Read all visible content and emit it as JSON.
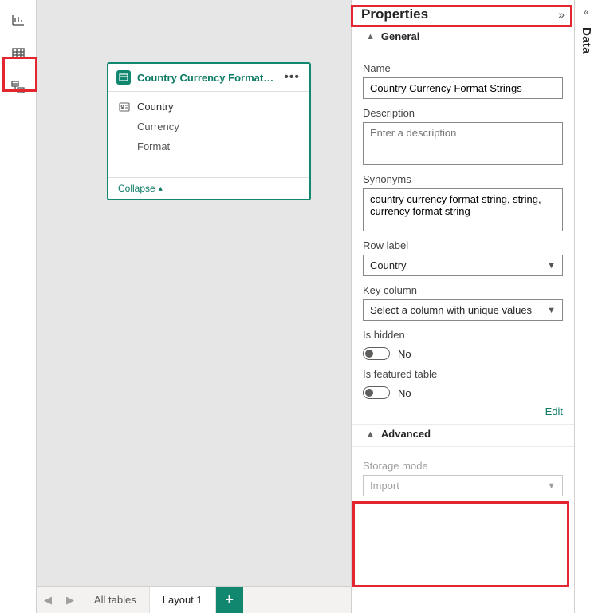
{
  "rail": {
    "report_tip": "Report view",
    "data_tip": "Data view",
    "model_tip": "Model view"
  },
  "card": {
    "title": "Country Currency Format Strings",
    "fields": [
      "Country",
      "Currency",
      "Format"
    ],
    "collapse": "Collapse"
  },
  "tabs": {
    "all": "All tables",
    "layout": "Layout 1"
  },
  "props": {
    "title": "Properties",
    "general": "General",
    "name_label": "Name",
    "name_value": "Country Currency Format Strings",
    "desc_label": "Description",
    "desc_placeholder": "Enter a description",
    "desc_value": "",
    "syn_label": "Synonyms",
    "syn_value": "country currency format string, string, currency format string",
    "rowlabel_label": "Row label",
    "rowlabel_value": "Country",
    "keycol_label": "Key column",
    "keycol_value": "Select a column with unique values",
    "hidden_label": "Is hidden",
    "hidden_value": "No",
    "featured_label": "Is featured table",
    "featured_value": "No",
    "edit": "Edit",
    "advanced": "Advanced",
    "storage_label": "Storage mode",
    "storage_value": "Import"
  },
  "data_pane": {
    "label": "Data"
  }
}
